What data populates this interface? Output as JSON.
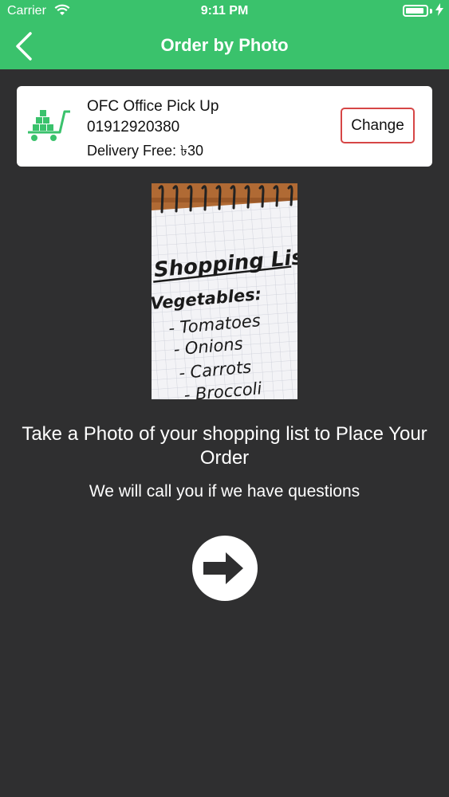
{
  "status_bar": {
    "carrier": "Carrier",
    "time": "9:11 PM",
    "battery_level": 1.0
  },
  "nav": {
    "title": "Order by Photo",
    "back_icon": "chevron-left-icon"
  },
  "store": {
    "name": "OFC Office Pick Up",
    "phone": "01912920380",
    "delivery_fee": "Delivery Free: ৳30",
    "change_label": "Change",
    "icon": "cart-icon",
    "change_border_color": "#d64646"
  },
  "photo": {
    "title": "Shopping List",
    "heading": "Vegetables:",
    "items": [
      "- Tomatoes",
      "- Onions",
      "- Carrots",
      "- Broccoli"
    ]
  },
  "instructions": {
    "main": "Take a Photo of your shopping list to Place Your Order",
    "sub": "We will call you if we have questions"
  },
  "next_button": {
    "icon": "arrow-right-icon"
  },
  "colors": {
    "accent": "#3ac26c",
    "background": "#2f2f30"
  }
}
